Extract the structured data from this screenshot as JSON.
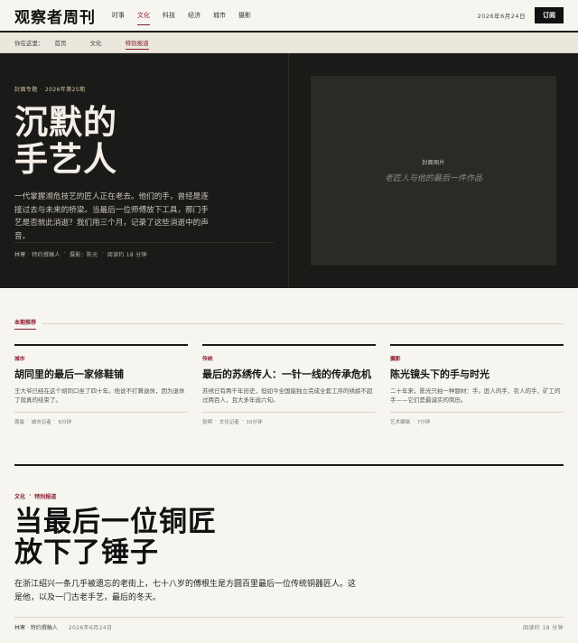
{
  "header": {
    "logo": "观察者周刊",
    "nav": [
      "时事",
      "文化",
      "科技",
      "经济",
      "城市",
      "摄影"
    ],
    "active_nav": "文化",
    "date": "2026年6月24日",
    "subscribe": "订阅"
  },
  "breadcrumb": {
    "label": "你在这里：",
    "items": [
      "首页",
      "文化",
      "特别报道"
    ],
    "separator": "·"
  },
  "hero": {
    "kicker_a": "封面专题",
    "kicker_b": "2026年第25期",
    "title_line1": "沉默的",
    "title_line2": "手艺人",
    "description": "一代掌握濒危技艺的匠人正在老去。他们的手，曾经是连接过去与未来的桥梁。当最后一位师傅放下工具，那门手艺是否就此消逝？我们用三个月，记录了这些消逝中的声音。",
    "meta": [
      "林寒 · 特约撰稿人",
      "·",
      "摄影：陈光",
      "·",
      "阅读约 18 分钟"
    ],
    "image_label": "封面图片",
    "image_caption": "老匠人与他的最后一件作品"
  },
  "recommend": {
    "heading": "本期推荐",
    "cards": [
      {
        "category": "城市",
        "title": "胡同里的最后一家修鞋铺",
        "summary": "王大爷已经在这个胡同口坐了四十年。他说不打算退休，因为退休了就真的结束了。",
        "author": "周晨",
        "role": "城市记者",
        "read": "6分钟"
      },
      {
        "category": "传统",
        "title": "最后的苏绣传人：一针一线的传承危机",
        "summary": "苏绣已有两千年历史，但如今全国能独立完成全套工序的绣娘不超过两百人，且大多年逾六旬。",
        "author": "张明",
        "role": "文化记者",
        "read": "10分钟"
      },
      {
        "category": "摄影",
        "title": "陈光镜头下的手与时光",
        "summary": "二十年来，陈光只拍一种题材：手。匠人的手、农人的手、矿工的手——它们是最诚实的简历。",
        "author": "艺术编辑",
        "role": "",
        "read": "7分钟"
      }
    ]
  },
  "feature": {
    "kicker_a": "文化",
    "kicker_b": "特别报道",
    "title_line1": "当最后一位铜匠",
    "title_line2": "放下了锤子",
    "description": "在浙江绍兴一条几乎被遗忘的老街上，七十八岁的傅根生是方圆百里最后一位传统铜器匠人。这是他，以及一门古老手艺，最后的冬天。",
    "author": "林寒 · 特约撰稿人",
    "date": "2026年6月24日",
    "read": "阅读约 18 分钟"
  }
}
